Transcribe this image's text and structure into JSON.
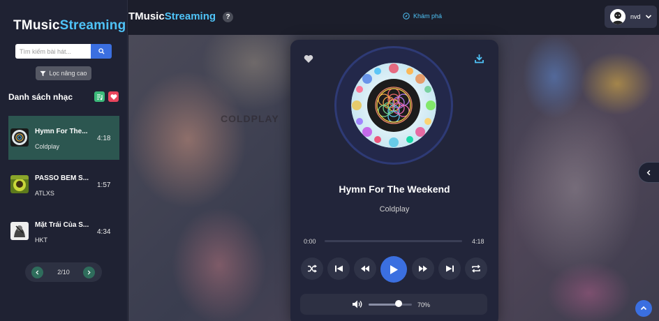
{
  "app": {
    "brand_part1": "TMusic",
    "brand_part2": "Streaming",
    "accent_color": "#4fc3f7",
    "primary_color": "#3b6fe0"
  },
  "sidebar": {
    "search_placeholder": "Tìm kiếm bài hát...",
    "filter_label": "Lọc nâng cao",
    "list_title": "Danh sách nhạc",
    "songs": [
      {
        "title": "Hymn For The...",
        "artist": "Coldplay",
        "duration": "4:18",
        "active": true
      },
      {
        "title": "PASSO BEM S...",
        "artist": "ATLXS",
        "duration": "1:57",
        "active": false
      },
      {
        "title": "Mặt Trái Của S...",
        "artist": "HKT",
        "duration": "4:34",
        "active": false
      }
    ],
    "pagination": "2/10"
  },
  "topbar": {
    "help_label": "?",
    "explore_label": "Khám phá",
    "username": "nvd"
  },
  "background": {
    "banner_text": "COLDPLAY"
  },
  "player": {
    "title": "Hymn For The Weekend",
    "artist": "Coldplay",
    "current_time": "0:00",
    "total_time": "4:18",
    "progress": 0.0,
    "volume_label": "70%",
    "volume": 0.7
  }
}
